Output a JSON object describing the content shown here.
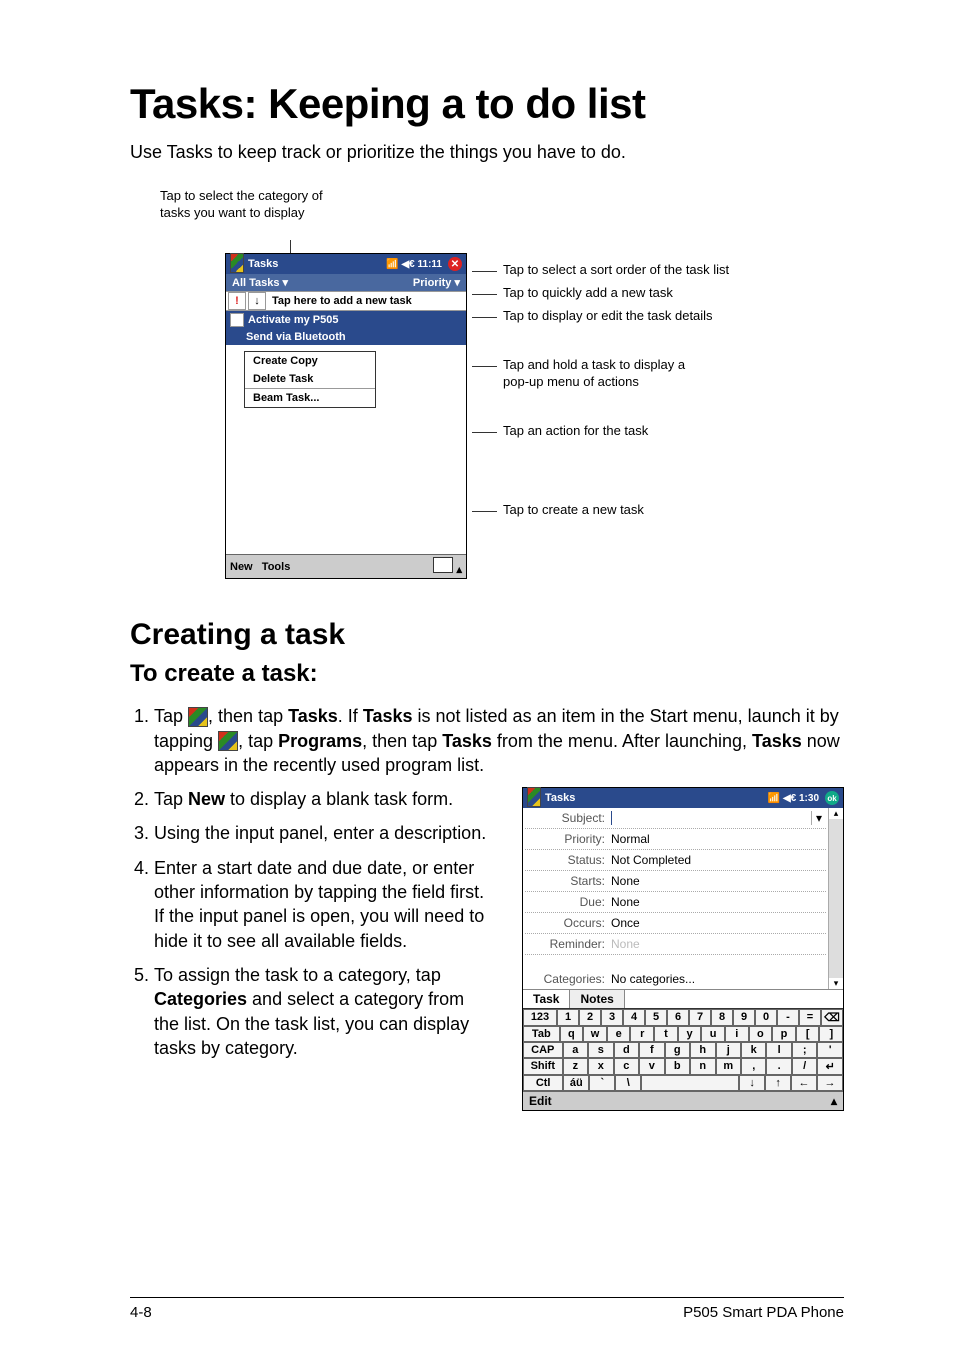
{
  "page": {
    "title": "Tasks: Keeping a to do list",
    "intro": "Use Tasks to keep track or prioritize the things you have to do.",
    "h2": "Creating a task",
    "h3": "To create a task:",
    "footer_left": "4-8",
    "footer_right": "P505 Smart PDA Phone"
  },
  "figure1": {
    "top_caption": "Tap to select the category of tasks you want to display",
    "device": {
      "titlebar": {
        "app": "Tasks",
        "time": "11:11",
        "signal_icon": "📶",
        "speaker_icon": "◀€"
      },
      "subbar": {
        "left": "All Tasks ▾",
        "right": "Priority ▾"
      },
      "addrow": {
        "exclaim": "!",
        "arrow": "↓",
        "text": "Tap here to add a new task"
      },
      "task1": "Activate my P505",
      "task2": "Send via Bluetooth",
      "popup": {
        "item1": "Create Copy",
        "item2": "Delete Task",
        "item3": "Beam Task..."
      },
      "bottombar": {
        "left_new": "New",
        "left_tools": "Tools"
      }
    },
    "callouts": {
      "c1": "Tap to select a sort order of the task list",
      "c2": "Tap to quickly add a new task",
      "c3": "Tap to display or edit the task details",
      "c4a": "Tap and hold a task to display a",
      "c4b": "pop-up menu of actions",
      "c5": "Tap an action for the task",
      "c6": "Tap to create a new task"
    }
  },
  "steps": {
    "s1a": "Tap ",
    "s1b": ", then tap ",
    "s1_tasks": "Tasks",
    "s1c": ". If ",
    "s1d": " is not listed as an item in the Start menu, launch it by tapping ",
    "s1e": ", tap ",
    "s1_programs": "Programs",
    "s1f": ", then tap ",
    "s1g": " from the menu. After launching, ",
    "s1h": " now appears in the recently used program list.",
    "s2a": "Tap ",
    "s2_new": "New",
    "s2b": " to display a blank task form.",
    "s3": "Using the input panel, enter a description.",
    "s4": "Enter a start date and due date, or enter other information by tapping the field first. If the input panel is open, you will need to hide it to see all available fields.",
    "s5a": "To assign the task to a category, tap ",
    "s5_categories": "Categories",
    "s5b": " and select a category from the list. On the task list, you can display tasks by category."
  },
  "device2": {
    "titlebar": {
      "app": "Tasks",
      "time": "1:30",
      "signal_icon": "📶",
      "speaker_icon": "◀€"
    },
    "form": {
      "subject_lbl": "Subject:",
      "subject_val": "",
      "priority_lbl": "Priority:",
      "priority_val": "Normal",
      "status_lbl": "Status:",
      "status_val": "Not Completed",
      "starts_lbl": "Starts:",
      "starts_val": "None",
      "due_lbl": "Due:",
      "due_val": "None",
      "occurs_lbl": "Occurs:",
      "occurs_val": "Once",
      "reminder_lbl": "Reminder:",
      "reminder_val": "None",
      "categories_lbl": "Categories:",
      "categories_val": "No categories..."
    },
    "tabs": {
      "task": "Task",
      "notes": "Notes"
    },
    "keyboard": {
      "row1": [
        "123",
        "1",
        "2",
        "3",
        "4",
        "5",
        "6",
        "7",
        "8",
        "9",
        "0",
        "-",
        "=",
        "⌫"
      ],
      "row2": [
        "Tab",
        "q",
        "w",
        "e",
        "r",
        "t",
        "y",
        "u",
        "i",
        "o",
        "p",
        "[",
        "]"
      ],
      "row3": [
        "CAP",
        "a",
        "s",
        "d",
        "f",
        "g",
        "h",
        "j",
        "k",
        "l",
        ";",
        "'"
      ],
      "row4": [
        "Shift",
        "z",
        "x",
        "c",
        "v",
        "b",
        "n",
        "m",
        ",",
        ".",
        "/",
        "↵"
      ],
      "row5": [
        "Ctl",
        "áü",
        "`",
        "\\",
        " ",
        "↓",
        "↑",
        "←",
        "→"
      ]
    },
    "bottombar": {
      "edit": "Edit"
    }
  }
}
